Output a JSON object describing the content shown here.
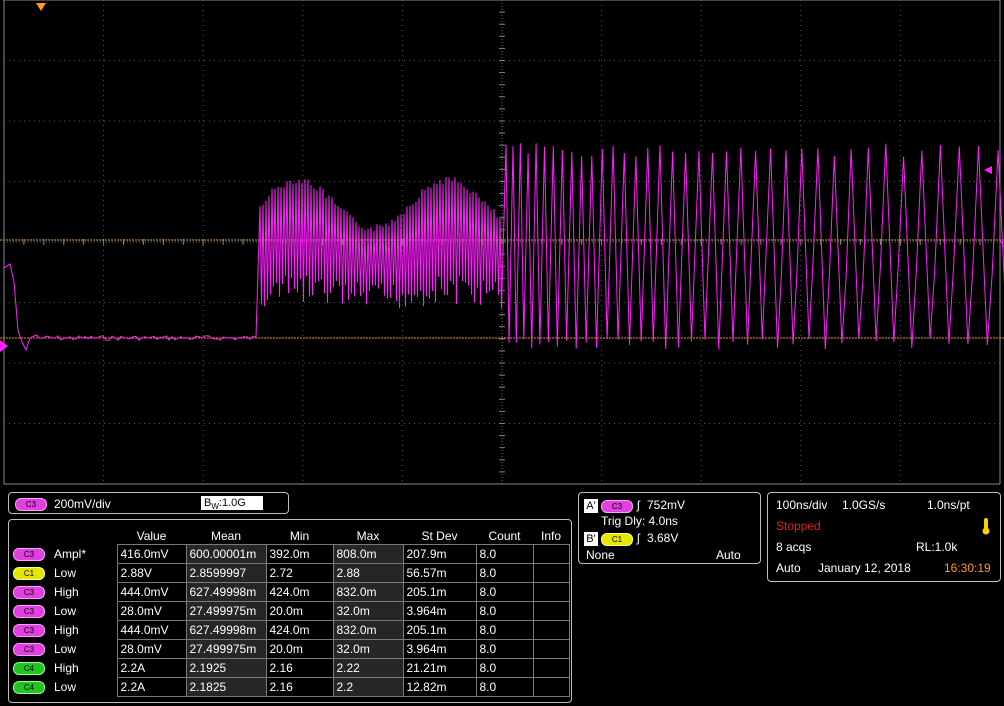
{
  "channel_settings": {
    "channel": "C3",
    "volts_per_div": "200mV/div",
    "bw_prefix": "B",
    "bw_sub": "W",
    "bw_value": ":1.0G"
  },
  "measurements": {
    "headers": [
      "Value",
      "Mean",
      "Min",
      "Max",
      "St Dev",
      "Count",
      "Info"
    ],
    "rows": [
      {
        "channel": "C3",
        "color": "magenta",
        "name": "Ampl*",
        "value": "416.0mV",
        "mean": "600.00001m",
        "min": "392.0m",
        "max": "808.0m",
        "stdev": "207.9m",
        "count": "8.0",
        "info": ""
      },
      {
        "channel": "C1",
        "color": "yellow",
        "name": "Low",
        "value": "2.88V",
        "mean": "2.8599997",
        "min": "2.72",
        "max": "2.88",
        "stdev": "56.57m",
        "count": "8.0",
        "info": ""
      },
      {
        "channel": "C3",
        "color": "magenta",
        "name": "High",
        "value": "444.0mV",
        "mean": "627.49998m",
        "min": "424.0m",
        "max": "832.0m",
        "stdev": "205.1m",
        "count": "8.0",
        "info": ""
      },
      {
        "channel": "C3",
        "color": "magenta",
        "name": "Low",
        "value": "28.0mV",
        "mean": "27.499975m",
        "min": "20.0m",
        "max": "32.0m",
        "stdev": "3.964m",
        "count": "8.0",
        "info": ""
      },
      {
        "channel": "C3",
        "color": "magenta",
        "name": "High",
        "value": "444.0mV",
        "mean": "627.49998m",
        "min": "424.0m",
        "max": "832.0m",
        "stdev": "205.1m",
        "count": "8.0",
        "info": ""
      },
      {
        "channel": "C3",
        "color": "magenta",
        "name": "Low",
        "value": "28.0mV",
        "mean": "27.499975m",
        "min": "20.0m",
        "max": "32.0m",
        "stdev": "3.964m",
        "count": "8.0",
        "info": ""
      },
      {
        "channel": "C4",
        "color": "green",
        "name": "High",
        "value": "2.2A",
        "mean": "2.1925",
        "min": "2.16",
        "max": "2.22",
        "stdev": "21.21m",
        "count": "8.0",
        "info": ""
      },
      {
        "channel": "C4",
        "color": "green",
        "name": "Low",
        "value": "2.2A",
        "mean": "2.1825",
        "min": "2.16",
        "max": "2.2",
        "stdev": "12.82m",
        "count": "8.0",
        "info": ""
      }
    ]
  },
  "trigger": {
    "a_label": "A'",
    "a_channel": "C3",
    "a_level": "752mV",
    "delay": "Trig Dly: 4.0ns",
    "b_label": "B'",
    "b_channel": "C1",
    "b_level": "3.68V",
    "b_mode": "None",
    "mode": "Auto"
  },
  "timebase": {
    "time_per_div": "100ns/div",
    "sample_rate": "1.0GS/s",
    "ns_per_pt": "1.0ns/pt",
    "state": "Stopped",
    "acqs": "8 acqs",
    "record_length": "RL:1.0k",
    "mode": "Auto",
    "date": "January 12, 2018",
    "time": "16:30:19"
  },
  "colors": {
    "trace": "#ff1fff",
    "cursor": "#e89a28",
    "grid": "#5a5a5a",
    "stopped": "#e02020",
    "clock": "#ff9a1a"
  },
  "icons": {
    "trigger_position_marker": "orange-triangle-down",
    "ground_marker": "magenta-arrow-right",
    "trigger_level_marker": "magenta-arrow-left",
    "acq_indicator": "thermometer-icon"
  }
}
